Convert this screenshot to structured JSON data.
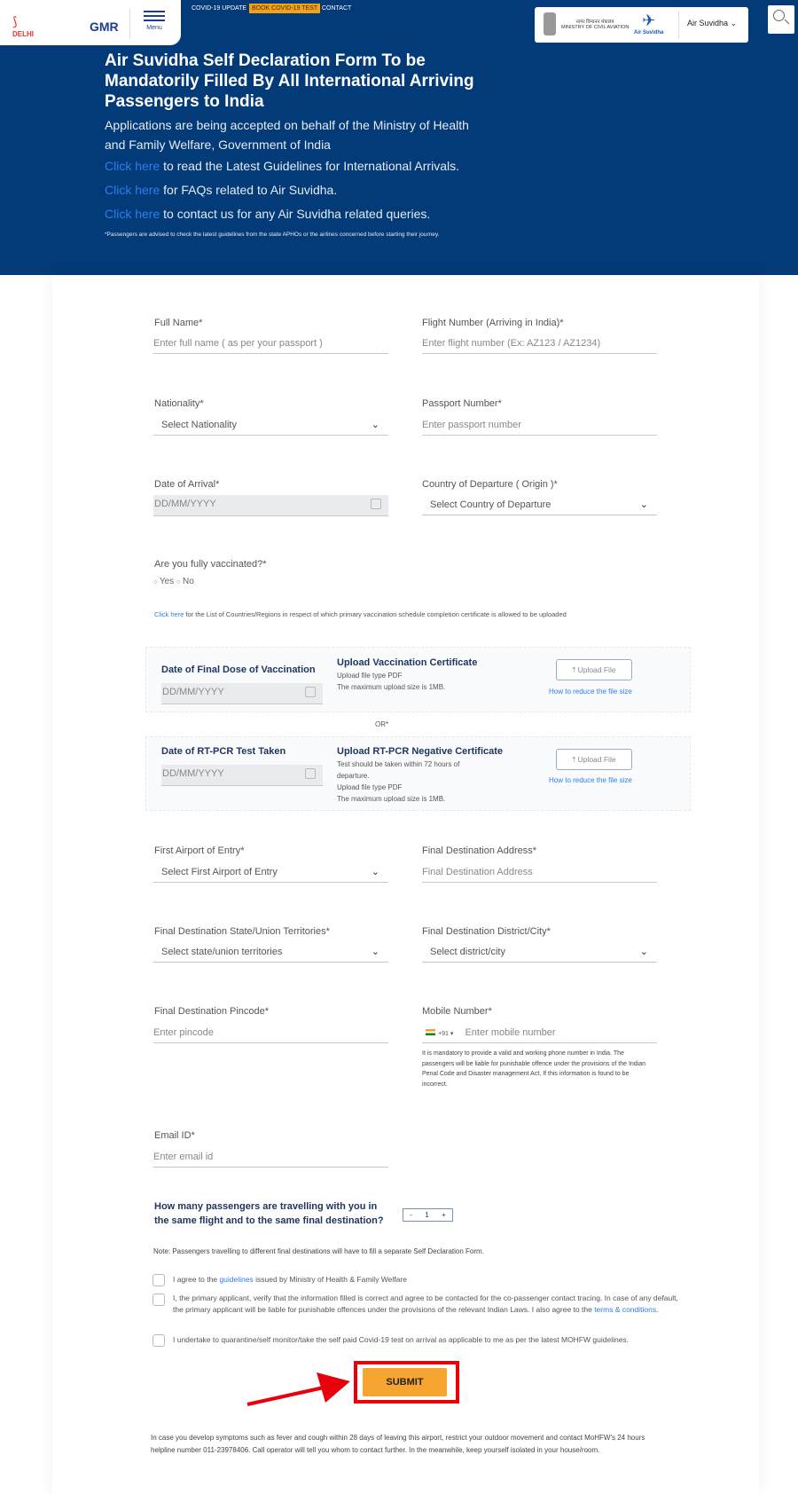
{
  "header": {
    "logo_text": "DELHI",
    "logo_sub": "INDIRA GANDHI INTERNATIONAL AIRPORT",
    "gmr_logo": "GMR",
    "menu_label": "Menu",
    "nav": [
      "COVID-19 UPDATE",
      "BOOK COVID-19 TEST",
      "CONTACT"
    ],
    "ministry_hindi": "नागर विमानन मंत्रालय",
    "ministry": "MINISTRY OF CIVIL AVIATION",
    "air_suvidha_logo": "Air Suvidha",
    "dropdown": "Air Suvidha",
    "title": "Air Suvidha Self Declaration Form To be Mandatorily Filled By All International Arriving Passengers to India",
    "subtitle": "Applications are being accepted on behalf of the Ministry of Health and Family Welfare, Government of India",
    "links": [
      {
        "link": "Click here",
        "text": " to read the Latest Guidelines for International Arrivals."
      },
      {
        "link": "Click here",
        "text": " for FAQs related to Air Suvidha."
      },
      {
        "link": "Click here",
        "text": " to contact us for any Air Suvidha related queries."
      }
    ],
    "advisory": "*Passengers are advised to check the latest guidelines from the state APHOs or the airlines concerned before starting their journey.",
    "brand_color": "#033a78",
    "accent_color": "#f6a112"
  },
  "form": {
    "full_name": {
      "label": "Full Name*",
      "placeholder": "Enter full name ( as per your passport )"
    },
    "flight": {
      "label": "Flight Number (Arriving in India)*",
      "placeholder": "Enter flight number (Ex: AZ123 / AZ1234)"
    },
    "nationality": {
      "label": "Nationality*",
      "value": "Select Nationality"
    },
    "passport": {
      "label": "Passport Number*",
      "placeholder": "Enter passport number"
    },
    "arrival": {
      "label": "Date of Arrival*",
      "placeholder": "DD/MM/YYYY"
    },
    "departure": {
      "label": "Country of Departure ( Origin )*",
      "value": "Select Country of Departure"
    },
    "vaccinated": {
      "label": "Are you fully vaccinated?*",
      "yes": "Yes",
      "no": "No"
    },
    "countries_link": "Click here",
    "countries_text": " for the List of Countries/Regions in respect of which primary vaccination schedule completion certificate is allowed to be uploaded",
    "vacc_box": {
      "date_label": "Date of Final Dose of Vaccination",
      "placeholder": "DD/MM/YYYY",
      "title": "Upload Vaccination Certificate",
      "l1": "Upload file type PDF",
      "l2": "The maximum upload size is 1MB.",
      "button": "Upload File",
      "reduce": "How to reduce the file size"
    },
    "or": "OR*",
    "pcr_box": {
      "date_label": "Date of RT-PCR Test Taken",
      "placeholder": "DD/MM/YYYY",
      "title": "Upload RT-PCR Negative Certificate",
      "l1": "Test should be taken within 72 hours of departure.",
      "l2": "Upload file type PDF",
      "l3": "The maximum upload size is 1MB.",
      "button": "Upload File",
      "reduce": "How to reduce the file size"
    },
    "airport": {
      "label": "First Airport of Entry*",
      "value": "Select First Airport of Entry"
    },
    "address": {
      "label": "Final Destination Address*",
      "placeholder": "Final Destination Address"
    },
    "state": {
      "label": "Final Destination State/Union Territories*",
      "value": "Select state/union territories"
    },
    "district": {
      "label": "Final Destination District/City*",
      "value": "Select district/city"
    },
    "pincode": {
      "label": "Final Destination Pincode*",
      "placeholder": "Enter pincode"
    },
    "mobile": {
      "label": "Mobile Number*",
      "code": "+91 ▾",
      "placeholder": "Enter mobile number",
      "note": "It is mandatory to provide a valid and working phone number in India. The passengers will be liable for punishable offence under the provisions of the Indian Penal Code and Disaster management Act, If this information is found to be incorrect."
    },
    "email": {
      "label": "Email ID*",
      "placeholder": "Enter email id"
    },
    "passengers": {
      "question": "How many passengers are travelling with you in the same flight and to the same final destination?",
      "minus": "-",
      "value": "1",
      "plus": "+"
    },
    "note": "Note: Passengers travelling to different final destinations will have to fill a separate Self Declaration Form.",
    "checks": [
      {
        "pre": "I agree to the ",
        "link": "guidelines",
        "post": " issued by Ministry of Health & Family Welfare"
      },
      {
        "pre": "I, the primary applicant, verify that the information filled is correct and agree to be contacted for the co-passenger contact tracing. In case of any default, the primary applicant will be liable for punishable offences under the provisions of the relevant Indian Laws. I also agree to the ",
        "link": "terms & conditions",
        "post": "."
      },
      {
        "pre": "I undertake to quarantine/self monitor/take the self paid Covid-19 test on arrival as applicable to me as per the latest MOHFW guidelines.",
        "link": "",
        "post": ""
      }
    ],
    "submit": "SUBMIT",
    "footer": "In case you develop symptoms such as fever and cough within 28 days of leaving this airport, restrict your outdoor movement and contact MoHFW's 24 hours helpline number 011-23978406. Call operator will tell you whom to contact further. In the meanwhile, keep yourself isolated in your house/room."
  }
}
